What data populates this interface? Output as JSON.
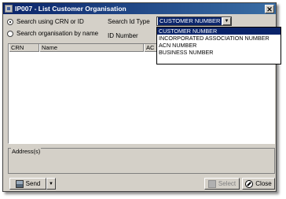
{
  "window": {
    "title": "IP007 - List Customer Organisation"
  },
  "search_mode": {
    "crn_label": "Search using CRN or ID",
    "name_label": "Search organisation by name",
    "selected": "crn"
  },
  "search_id_type": {
    "label": "Search Id Type",
    "selected_value": "CUSTOMER NUMBER",
    "options": [
      "CUSTOMER NUMBER",
      "INCORPORATED ASSOCIATION NUMBER",
      "ACN NUMBER",
      "BUSINESS NUMBER"
    ],
    "highlighted_index": 0
  },
  "id_number": {
    "label": "ID Number",
    "value": ""
  },
  "results_table": {
    "columns": [
      "CRN",
      "Name",
      "AC"
    ],
    "rows": []
  },
  "address_group": {
    "label": "Address(s)"
  },
  "buttons": {
    "send_label": "Send",
    "select_label": "Select",
    "close_label": "Close"
  },
  "icons": {
    "app": "app-window-icon",
    "send": "send-icon",
    "select": "select-icon",
    "close": "close-circle-icon"
  },
  "colors": {
    "title_bar": "#0a246a",
    "window_face": "#d4d0c8",
    "selection": "#0a246a"
  }
}
